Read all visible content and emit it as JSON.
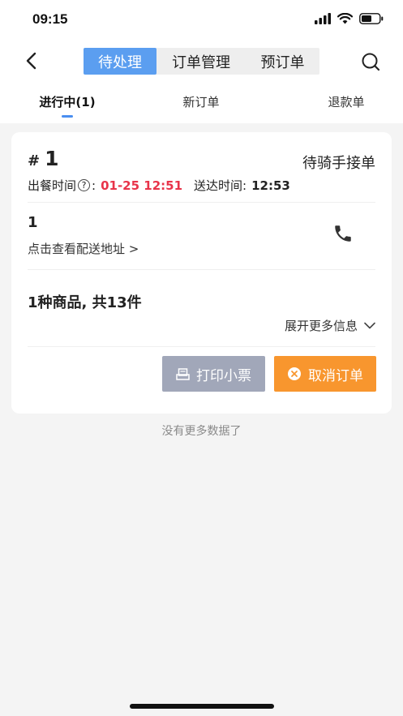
{
  "status_bar": {
    "time": "09:15"
  },
  "nav": {
    "segments": [
      {
        "label": "待处理",
        "active": true
      },
      {
        "label": "订单管理",
        "active": false
      },
      {
        "label": "预订单",
        "active": false
      }
    ]
  },
  "tabs": [
    {
      "label": "进行中(1)",
      "active": true
    },
    {
      "label": "新订单",
      "active": false
    },
    {
      "label": "退款单",
      "active": false
    }
  ],
  "order": {
    "hash": "#",
    "number": "1",
    "status": "待骑手接单",
    "meal_time_label": "出餐时间",
    "meal_time_sep": ":",
    "meal_time": "01-25 12:51",
    "deliver_label": "送达时间:",
    "deliver_time": "12:53",
    "customer": "1",
    "address_link": "点击查看配送地址 >",
    "goods_summary": "1种商品, 共13件",
    "expand_label": "展开更多信息",
    "print_label": "打印小票",
    "cancel_label": "取消订单",
    "accent_red": "#e8344a",
    "accent_orange": "#f8962e"
  },
  "footer": {
    "no_more": "没有更多数据了"
  }
}
